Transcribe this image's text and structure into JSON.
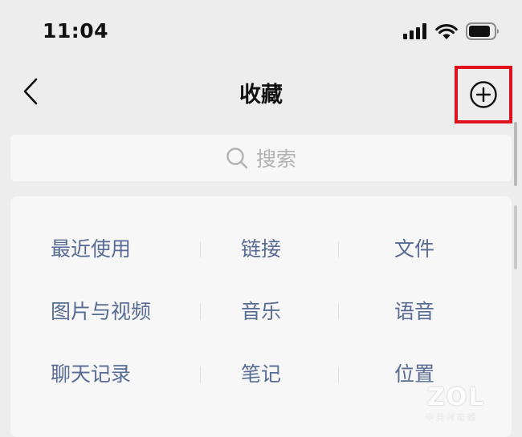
{
  "status_bar": {
    "time": "11:04"
  },
  "nav": {
    "title": "收藏",
    "back_icon": "chevron-left-icon",
    "add_icon": "plus-circle-icon",
    "highlight_color": "#e0101c"
  },
  "search": {
    "placeholder": "搜索",
    "icon": "search-icon"
  },
  "categories": {
    "link_color": "#576b95",
    "rows": [
      [
        "最近使用",
        "链接",
        "文件"
      ],
      [
        "图片与视频",
        "音乐",
        "语音"
      ],
      [
        "聊天记录",
        "笔记",
        "位置"
      ]
    ]
  },
  "watermark": {
    "logo": "ZOL",
    "sub": "中关村在线"
  }
}
